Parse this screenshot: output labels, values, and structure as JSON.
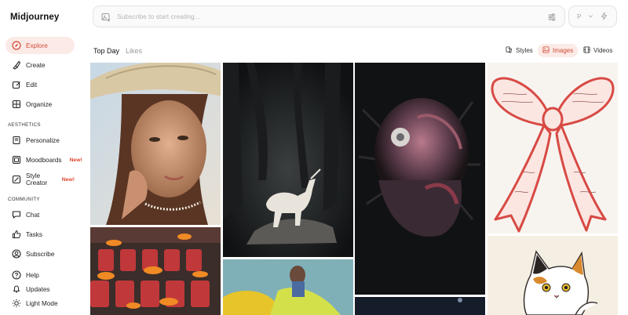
{
  "brand": "Midjourney",
  "nav": {
    "explore": "Explore",
    "create": "Create",
    "edit": "Edit",
    "organize": "Organize",
    "aesthetics_label": "AESTHETICS",
    "personalize": "Personalize",
    "moodboards": "Moodboards",
    "style_creator": "Style Creator",
    "new_badge": "New!",
    "community_label": "COMMUNITY",
    "chat": "Chat",
    "tasks": "Tasks",
    "subscribe": "Subscribe",
    "help": "Help",
    "updates": "Updates",
    "light_mode": "Light Mode"
  },
  "prompt": {
    "placeholder": "Subscribe to start creating..."
  },
  "side_box": {
    "letter": "P"
  },
  "feed_tabs": {
    "top_day": "Top Day",
    "likes": "Likes"
  },
  "media_tabs": {
    "styles": "Styles",
    "images": "Images",
    "videos": "Videos"
  },
  "colors": {
    "accent": "#d24a36",
    "accent_bg": "#fbeae6"
  }
}
